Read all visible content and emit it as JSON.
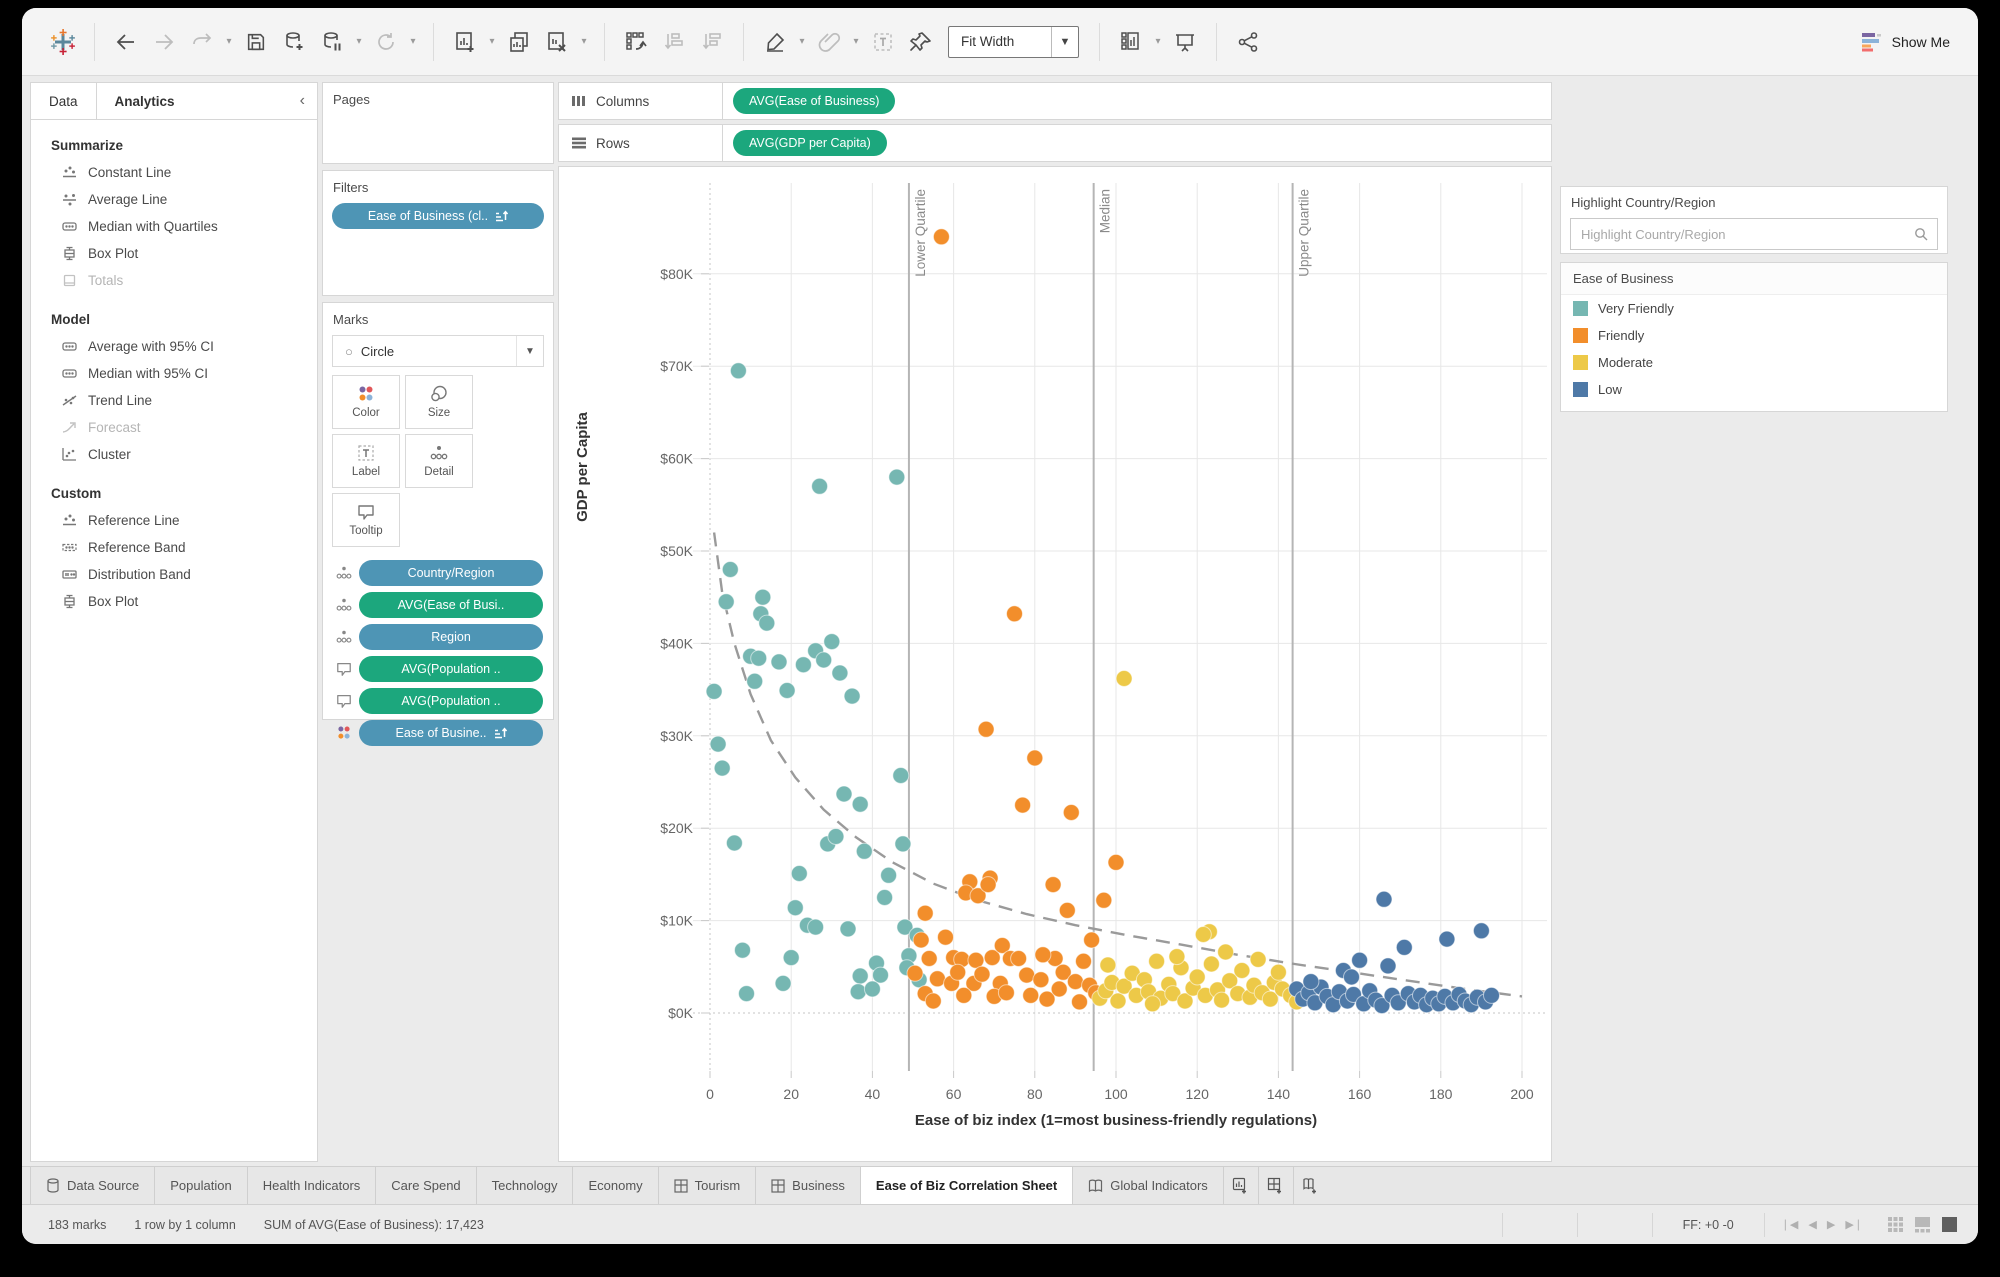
{
  "toolbar": {
    "fit_mode": "Fit Width",
    "show_me": "Show Me"
  },
  "sidebar": {
    "tab_data": "Data",
    "tab_analytics": "Analytics",
    "sections": [
      {
        "title": "Summarize",
        "items": [
          {
            "label": "Constant Line"
          },
          {
            "label": "Average Line"
          },
          {
            "label": "Median with Quartiles"
          },
          {
            "label": "Box Plot"
          },
          {
            "label": "Totals",
            "disabled": true
          }
        ]
      },
      {
        "title": "Model",
        "items": [
          {
            "label": "Average with 95% CI"
          },
          {
            "label": "Median with 95% CI"
          },
          {
            "label": "Trend Line"
          },
          {
            "label": "Forecast",
            "disabled": true
          },
          {
            "label": "Cluster"
          }
        ]
      },
      {
        "title": "Custom",
        "items": [
          {
            "label": "Reference Line"
          },
          {
            "label": "Reference Band"
          },
          {
            "label": "Distribution Band"
          },
          {
            "label": "Box Plot"
          }
        ]
      }
    ]
  },
  "shelves": {
    "pages_title": "Pages",
    "filters_title": "Filters",
    "filter_pill": "Ease of Business (cl..",
    "marks_title": "Marks",
    "mark_type": "Circle",
    "buttons": {
      "color": "Color",
      "size": "Size",
      "label": "Label",
      "detail": "Detail",
      "tooltip": "Tooltip"
    },
    "mark_pills": [
      {
        "icon": "detail",
        "label": "Country/Region",
        "color": "blue"
      },
      {
        "icon": "detail",
        "label": "AVG(Ease of Busi..",
        "color": "green"
      },
      {
        "icon": "detail",
        "label": "Region",
        "color": "blue"
      },
      {
        "icon": "tooltip",
        "label": "AVG(Population ..",
        "color": "green"
      },
      {
        "icon": "tooltip",
        "label": "AVG(Population ..",
        "color": "green"
      },
      {
        "icon": "color",
        "label": "Ease of Busine..",
        "color": "blue",
        "sorted": true
      }
    ],
    "columns_label": "Columns",
    "columns_pill": "AVG(Ease of Business)",
    "rows_label": "Rows",
    "rows_pill": "AVG(GDP per Capita)"
  },
  "ui_colors": {
    "pill_green": "#1CA77D",
    "pill_blue": "#4E95B5"
  },
  "right_panel": {
    "highlight": {
      "title": "Highlight Country/Region",
      "placeholder": "Highlight Country/Region"
    },
    "legend": {
      "title": "Ease of Business",
      "items": [
        {
          "label": "Very Friendly",
          "color": "#76B7B2"
        },
        {
          "label": "Friendly",
          "color": "#F28E2B"
        },
        {
          "label": "Moderate",
          "color": "#EDC948"
        },
        {
          "label": "Low",
          "color": "#4E79A7"
        }
      ]
    }
  },
  "chart_data": {
    "type": "scatter",
    "xlabel": "Ease of biz index (1=most business-friendly regulations)",
    "ylabel": "GDP per Capita",
    "xlim": [
      0,
      200
    ],
    "ylim_k": [
      0,
      85
    ],
    "x_ticks": [
      0,
      20,
      40,
      60,
      80,
      100,
      120,
      140,
      160,
      180,
      200
    ],
    "y_ticks_k": [
      0,
      10,
      20,
      30,
      40,
      50,
      60,
      70,
      80
    ],
    "y_tick_labels": [
      "$0K",
      "$10K",
      "$20K",
      "$30K",
      "$40K",
      "$50K",
      "$60K",
      "$70K",
      "$80K"
    ],
    "grid": true,
    "reference_lines": [
      {
        "value": 49,
        "label": "Lower Quartile"
      },
      {
        "value": 94.5,
        "label": "Median"
      },
      {
        "value": 143.5,
        "label": "Upper Quartile"
      }
    ],
    "trend_dashed_k": [
      [
        1,
        52
      ],
      [
        3,
        45.5
      ],
      [
        6,
        40
      ],
      [
        10,
        34.5
      ],
      [
        15,
        29.5
      ],
      [
        21,
        25.5
      ],
      [
        28,
        22
      ],
      [
        36,
        19
      ],
      [
        45,
        16.3
      ],
      [
        55,
        14
      ],
      [
        66,
        12.2
      ],
      [
        78,
        10.7
      ],
      [
        90,
        9.5
      ],
      [
        103,
        8.4
      ],
      [
        116,
        7.4
      ],
      [
        130,
        6.3
      ],
      [
        144,
        5.3
      ],
      [
        158,
        4.4
      ],
      [
        172,
        3.5
      ],
      [
        186,
        2.6
      ],
      [
        200,
        1.8
      ]
    ],
    "series": [
      {
        "name": "Very Friendly",
        "color": "#76B7B2",
        "points": [
          [
            7,
            69.5
          ],
          [
            27,
            57
          ],
          [
            46,
            58
          ],
          [
            5,
            48
          ],
          [
            4,
            44.5
          ],
          [
            13,
            45
          ],
          [
            12.5,
            43.2
          ],
          [
            14,
            42.2
          ],
          [
            30,
            40.2
          ],
          [
            10,
            38.6
          ],
          [
            12,
            38.4
          ],
          [
            17,
            38
          ],
          [
            23,
            37.7
          ],
          [
            26,
            39.2
          ],
          [
            28,
            38.2
          ],
          [
            32,
            36.8
          ],
          [
            11,
            35.9
          ],
          [
            1,
            34.8
          ],
          [
            19,
            34.9
          ],
          [
            35,
            34.3
          ],
          [
            2,
            29.1
          ],
          [
            3,
            26.5
          ],
          [
            47,
            25.7
          ],
          [
            33,
            23.7
          ],
          [
            37,
            22.6
          ],
          [
            6,
            18.4
          ],
          [
            29,
            18.3
          ],
          [
            31,
            19.1
          ],
          [
            38,
            17.5
          ],
          [
            47.5,
            18.3
          ],
          [
            44,
            14.9
          ],
          [
            22,
            15.1
          ],
          [
            43,
            12.5
          ],
          [
            21,
            11.4
          ],
          [
            24,
            9.5
          ],
          [
            26,
            9.3
          ],
          [
            34,
            9.1
          ],
          [
            48,
            9.3
          ],
          [
            51,
            8.4
          ],
          [
            8,
            6.8
          ],
          [
            20,
            6
          ],
          [
            41,
            5.4
          ],
          [
            42,
            4.1
          ],
          [
            37,
            4
          ],
          [
            18,
            3.2
          ],
          [
            36.5,
            2.3
          ],
          [
            40,
            2.6
          ],
          [
            9,
            2.1
          ],
          [
            49,
            6.2
          ],
          [
            48.5,
            4.9
          ],
          [
            51.5,
            3.6
          ]
        ]
      },
      {
        "name": "Friendly",
        "color": "#F28E2B",
        "points": [
          [
            57,
            84
          ],
          [
            75,
            43.2
          ],
          [
            68,
            30.7
          ],
          [
            80,
            27.6
          ],
          [
            77,
            22.5
          ],
          [
            89,
            21.7
          ],
          [
            64,
            14.2
          ],
          [
            69,
            14.6
          ],
          [
            63,
            13
          ],
          [
            66,
            12.7
          ],
          [
            53,
            10.8
          ],
          [
            68.5,
            13.9
          ],
          [
            84.5,
            13.9
          ],
          [
            100,
            16.3
          ],
          [
            97,
            12.2
          ],
          [
            88,
            11.1
          ],
          [
            52,
            7.9
          ],
          [
            58,
            8.2
          ],
          [
            54,
            5.9
          ],
          [
            60,
            6
          ],
          [
            62,
            5.8
          ],
          [
            65.5,
            5.7
          ],
          [
            69.5,
            6
          ],
          [
            72,
            7.3
          ],
          [
            74,
            5.9
          ],
          [
            76,
            5.9
          ],
          [
            50.5,
            4.3
          ],
          [
            56,
            3.7
          ],
          [
            59.5,
            3.2
          ],
          [
            65,
            3.2
          ],
          [
            71.5,
            3.2
          ],
          [
            78,
            4.1
          ],
          [
            81.5,
            3.6
          ],
          [
            53,
            2.1
          ],
          [
            62.5,
            1.9
          ],
          [
            70,
            1.8
          ],
          [
            85,
            5.9
          ],
          [
            87,
            4.4
          ],
          [
            90,
            3.4
          ],
          [
            92,
            5.6
          ],
          [
            93.5,
            3
          ],
          [
            95,
            2.2
          ],
          [
            83,
            1.5
          ],
          [
            86,
            2.6
          ],
          [
            91,
            1.2
          ],
          [
            55,
            1.3
          ],
          [
            61,
            4.4
          ],
          [
            67,
            4.2
          ],
          [
            73,
            2.2
          ],
          [
            79,
            1.9
          ],
          [
            82,
            6.3
          ],
          [
            94,
            7.9
          ]
        ]
      },
      {
        "name": "Moderate",
        "color": "#EDC948",
        "points": [
          [
            102,
            36.2
          ],
          [
            123,
            8.8
          ],
          [
            121.5,
            8.5
          ],
          [
            96,
            1.6
          ],
          [
            97.5,
            2.4
          ],
          [
            99,
            3.3
          ],
          [
            100.5,
            1.3
          ],
          [
            102,
            2.9
          ],
          [
            104,
            4.3
          ],
          [
            105,
            1.9
          ],
          [
            107,
            3.6
          ],
          [
            108,
            2.3
          ],
          [
            110,
            5.6
          ],
          [
            111,
            1.6
          ],
          [
            113,
            3.1
          ],
          [
            114,
            2.1
          ],
          [
            116,
            4.9
          ],
          [
            117,
            1.3
          ],
          [
            119,
            2.7
          ],
          [
            120,
            3.9
          ],
          [
            122,
            1.9
          ],
          [
            123.5,
            5.3
          ],
          [
            125,
            2.5
          ],
          [
            126,
            1.4
          ],
          [
            128,
            3.5
          ],
          [
            130,
            2.1
          ],
          [
            131,
            4.6
          ],
          [
            133,
            1.7
          ],
          [
            134,
            3
          ],
          [
            136,
            2.2
          ],
          [
            138,
            1.5
          ],
          [
            139,
            3.3
          ],
          [
            141,
            2.6
          ],
          [
            143,
            1.9
          ],
          [
            144.5,
            1.2
          ],
          [
            98,
            5.2
          ],
          [
            109,
            1
          ],
          [
            115,
            6.1
          ],
          [
            127,
            6.6
          ],
          [
            135,
            5.8
          ],
          [
            140,
            4.4
          ]
        ]
      },
      {
        "name": "Low",
        "color": "#4E79A7",
        "points": [
          [
            166,
            12.3
          ],
          [
            171,
            7.1
          ],
          [
            181.5,
            8
          ],
          [
            190,
            8.9
          ],
          [
            167,
            5.1
          ],
          [
            156,
            4.6
          ],
          [
            160,
            5.7
          ],
          [
            144.5,
            2.6
          ],
          [
            146,
            1.5
          ],
          [
            147.5,
            2.2
          ],
          [
            149,
            1.1
          ],
          [
            150.5,
            2.8
          ],
          [
            152,
            1.8
          ],
          [
            153.5,
            0.9
          ],
          [
            155,
            2.3
          ],
          [
            157,
            1.3
          ],
          [
            158.5,
            2
          ],
          [
            161,
            1
          ],
          [
            162.5,
            2.4
          ],
          [
            164,
            1.4
          ],
          [
            165.5,
            0.8
          ],
          [
            168,
            1.9
          ],
          [
            169.5,
            1.1
          ],
          [
            172,
            2.1
          ],
          [
            173.5,
            1.2
          ],
          [
            175,
            1.9
          ],
          [
            176.5,
            0.9
          ],
          [
            178,
            1.6
          ],
          [
            179.5,
            1
          ],
          [
            181,
            1.8
          ],
          [
            183,
            1.1
          ],
          [
            184.5,
            2
          ],
          [
            186,
            1.3
          ],
          [
            187.5,
            0.9
          ],
          [
            189,
            1.7
          ],
          [
            191,
            1.2
          ],
          [
            192.5,
            1.9
          ],
          [
            158,
            3.9
          ],
          [
            148,
            3.4
          ]
        ]
      }
    ]
  },
  "bottom_tabs": {
    "tabs": [
      {
        "label": "Data Source",
        "icon": "datasource"
      },
      {
        "label": "Population"
      },
      {
        "label": "Health Indicators"
      },
      {
        "label": "Care Spend"
      },
      {
        "label": "Technology"
      },
      {
        "label": "Economy"
      },
      {
        "label": "Tourism",
        "icon": "dashboard"
      },
      {
        "label": "Business",
        "icon": "dashboard"
      },
      {
        "label": "Ease of Biz Correlation Sheet",
        "active": true
      },
      {
        "label": "Global Indicators",
        "icon": "story"
      }
    ]
  },
  "status_bar": {
    "marks": "183 marks",
    "size": "1 row by 1 column",
    "aggregate": "SUM of AVG(Ease of Business): 17,423",
    "ff": "FF: +0 -0"
  }
}
